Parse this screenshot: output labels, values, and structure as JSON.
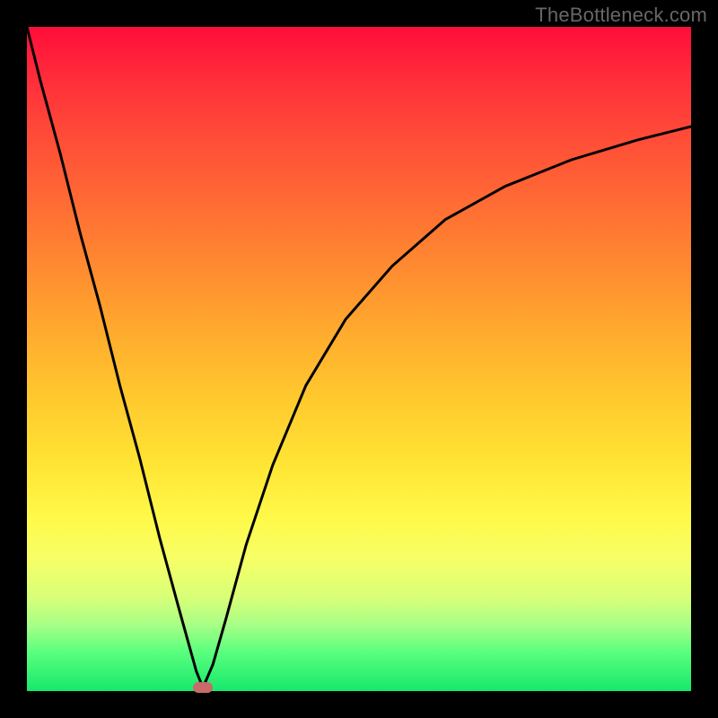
{
  "watermark": {
    "text": "TheBottleneck.com"
  },
  "colors": {
    "curve": "#000000",
    "marker": "#c86a6a",
    "frame": "#000000",
    "gradient_stops": [
      "#ff0d3a",
      "#ff2e3a",
      "#ff4a38",
      "#ff6a34",
      "#ff8a30",
      "#ffab2e",
      "#ffc92e",
      "#ffe534",
      "#fff94a",
      "#f7ff66",
      "#d7ff78",
      "#a8ff86",
      "#5cff7e",
      "#17e86b"
    ]
  },
  "chart_data": {
    "type": "line",
    "title": "",
    "xlabel": "",
    "ylabel": "",
    "xlim": [
      0,
      100
    ],
    "ylim": [
      0,
      100
    ],
    "series": [
      {
        "name": "left-branch",
        "x": [
          0,
          2,
          5,
          8,
          11,
          14,
          17,
          20,
          23,
          25.5,
          26.5
        ],
        "y": [
          100,
          92,
          81,
          69,
          58,
          46,
          35,
          23,
          12,
          3,
          0.5
        ]
      },
      {
        "name": "right-branch",
        "x": [
          26.5,
          28,
          30,
          33,
          37,
          42,
          48,
          55,
          63,
          72,
          82,
          92,
          100
        ],
        "y": [
          0.5,
          4,
          11,
          22,
          34,
          46,
          56,
          64,
          71,
          76,
          80,
          83,
          85
        ]
      }
    ],
    "annotations": [
      {
        "name": "min-marker",
        "x": 26.5,
        "y": 0.5
      }
    ]
  }
}
